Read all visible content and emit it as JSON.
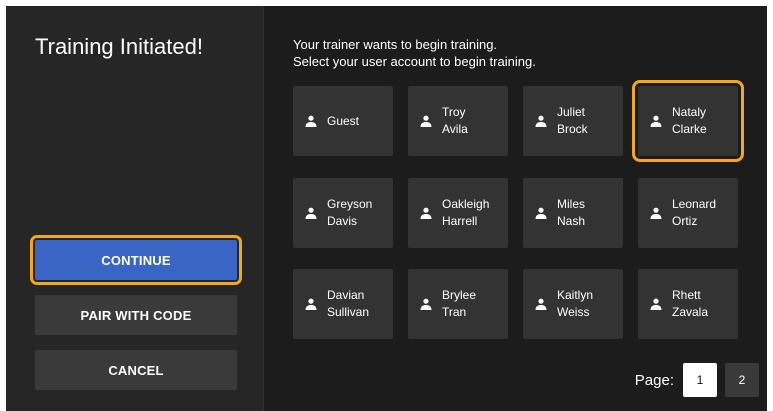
{
  "left": {
    "title": "Training Initiated!",
    "buttons": {
      "continue": "CONTINUE",
      "pair_with_code": "PAIR WITH CODE",
      "cancel": "CANCEL"
    }
  },
  "right": {
    "instructions": [
      "Your trainer wants to begin training.",
      "Select your user account to begin training."
    ],
    "users": [
      {
        "name": "Guest",
        "icon": "person-icon",
        "selected": false
      },
      {
        "name": "Troy\nAvila",
        "icon": "person-icon",
        "selected": false
      },
      {
        "name": "Juliet\nBrock",
        "icon": "person-icon",
        "selected": false
      },
      {
        "name": "Nataly\nClarke",
        "icon": "person-icon",
        "selected": true
      },
      {
        "name": "Greyson\nDavis",
        "icon": "person-icon",
        "selected": false
      },
      {
        "name": "Oakleigh\nHarrell",
        "icon": "person-icon",
        "selected": false
      },
      {
        "name": "Miles\nNash",
        "icon": "person-icon",
        "selected": false
      },
      {
        "name": "Leonard\nOrtiz",
        "icon": "person-icon",
        "selected": false
      },
      {
        "name": "Davian\nSullivan",
        "icon": "person-icon",
        "selected": false
      },
      {
        "name": "Brylee\nTran",
        "icon": "person-icon",
        "selected": false
      },
      {
        "name": "Kaitlyn\nWeiss",
        "icon": "person-icon",
        "selected": false
      },
      {
        "name": "Rhett\nZavala",
        "icon": "person-icon",
        "selected": false
      }
    ],
    "pagination": {
      "label": "Page:",
      "pages": [
        "1",
        "2"
      ],
      "current": "1"
    }
  },
  "colors": {
    "accent_blue": "#3a65c4",
    "focus_outline": "#f0a81e",
    "background": "#1c1c1c",
    "panel": "#262626",
    "card": "#333333"
  }
}
